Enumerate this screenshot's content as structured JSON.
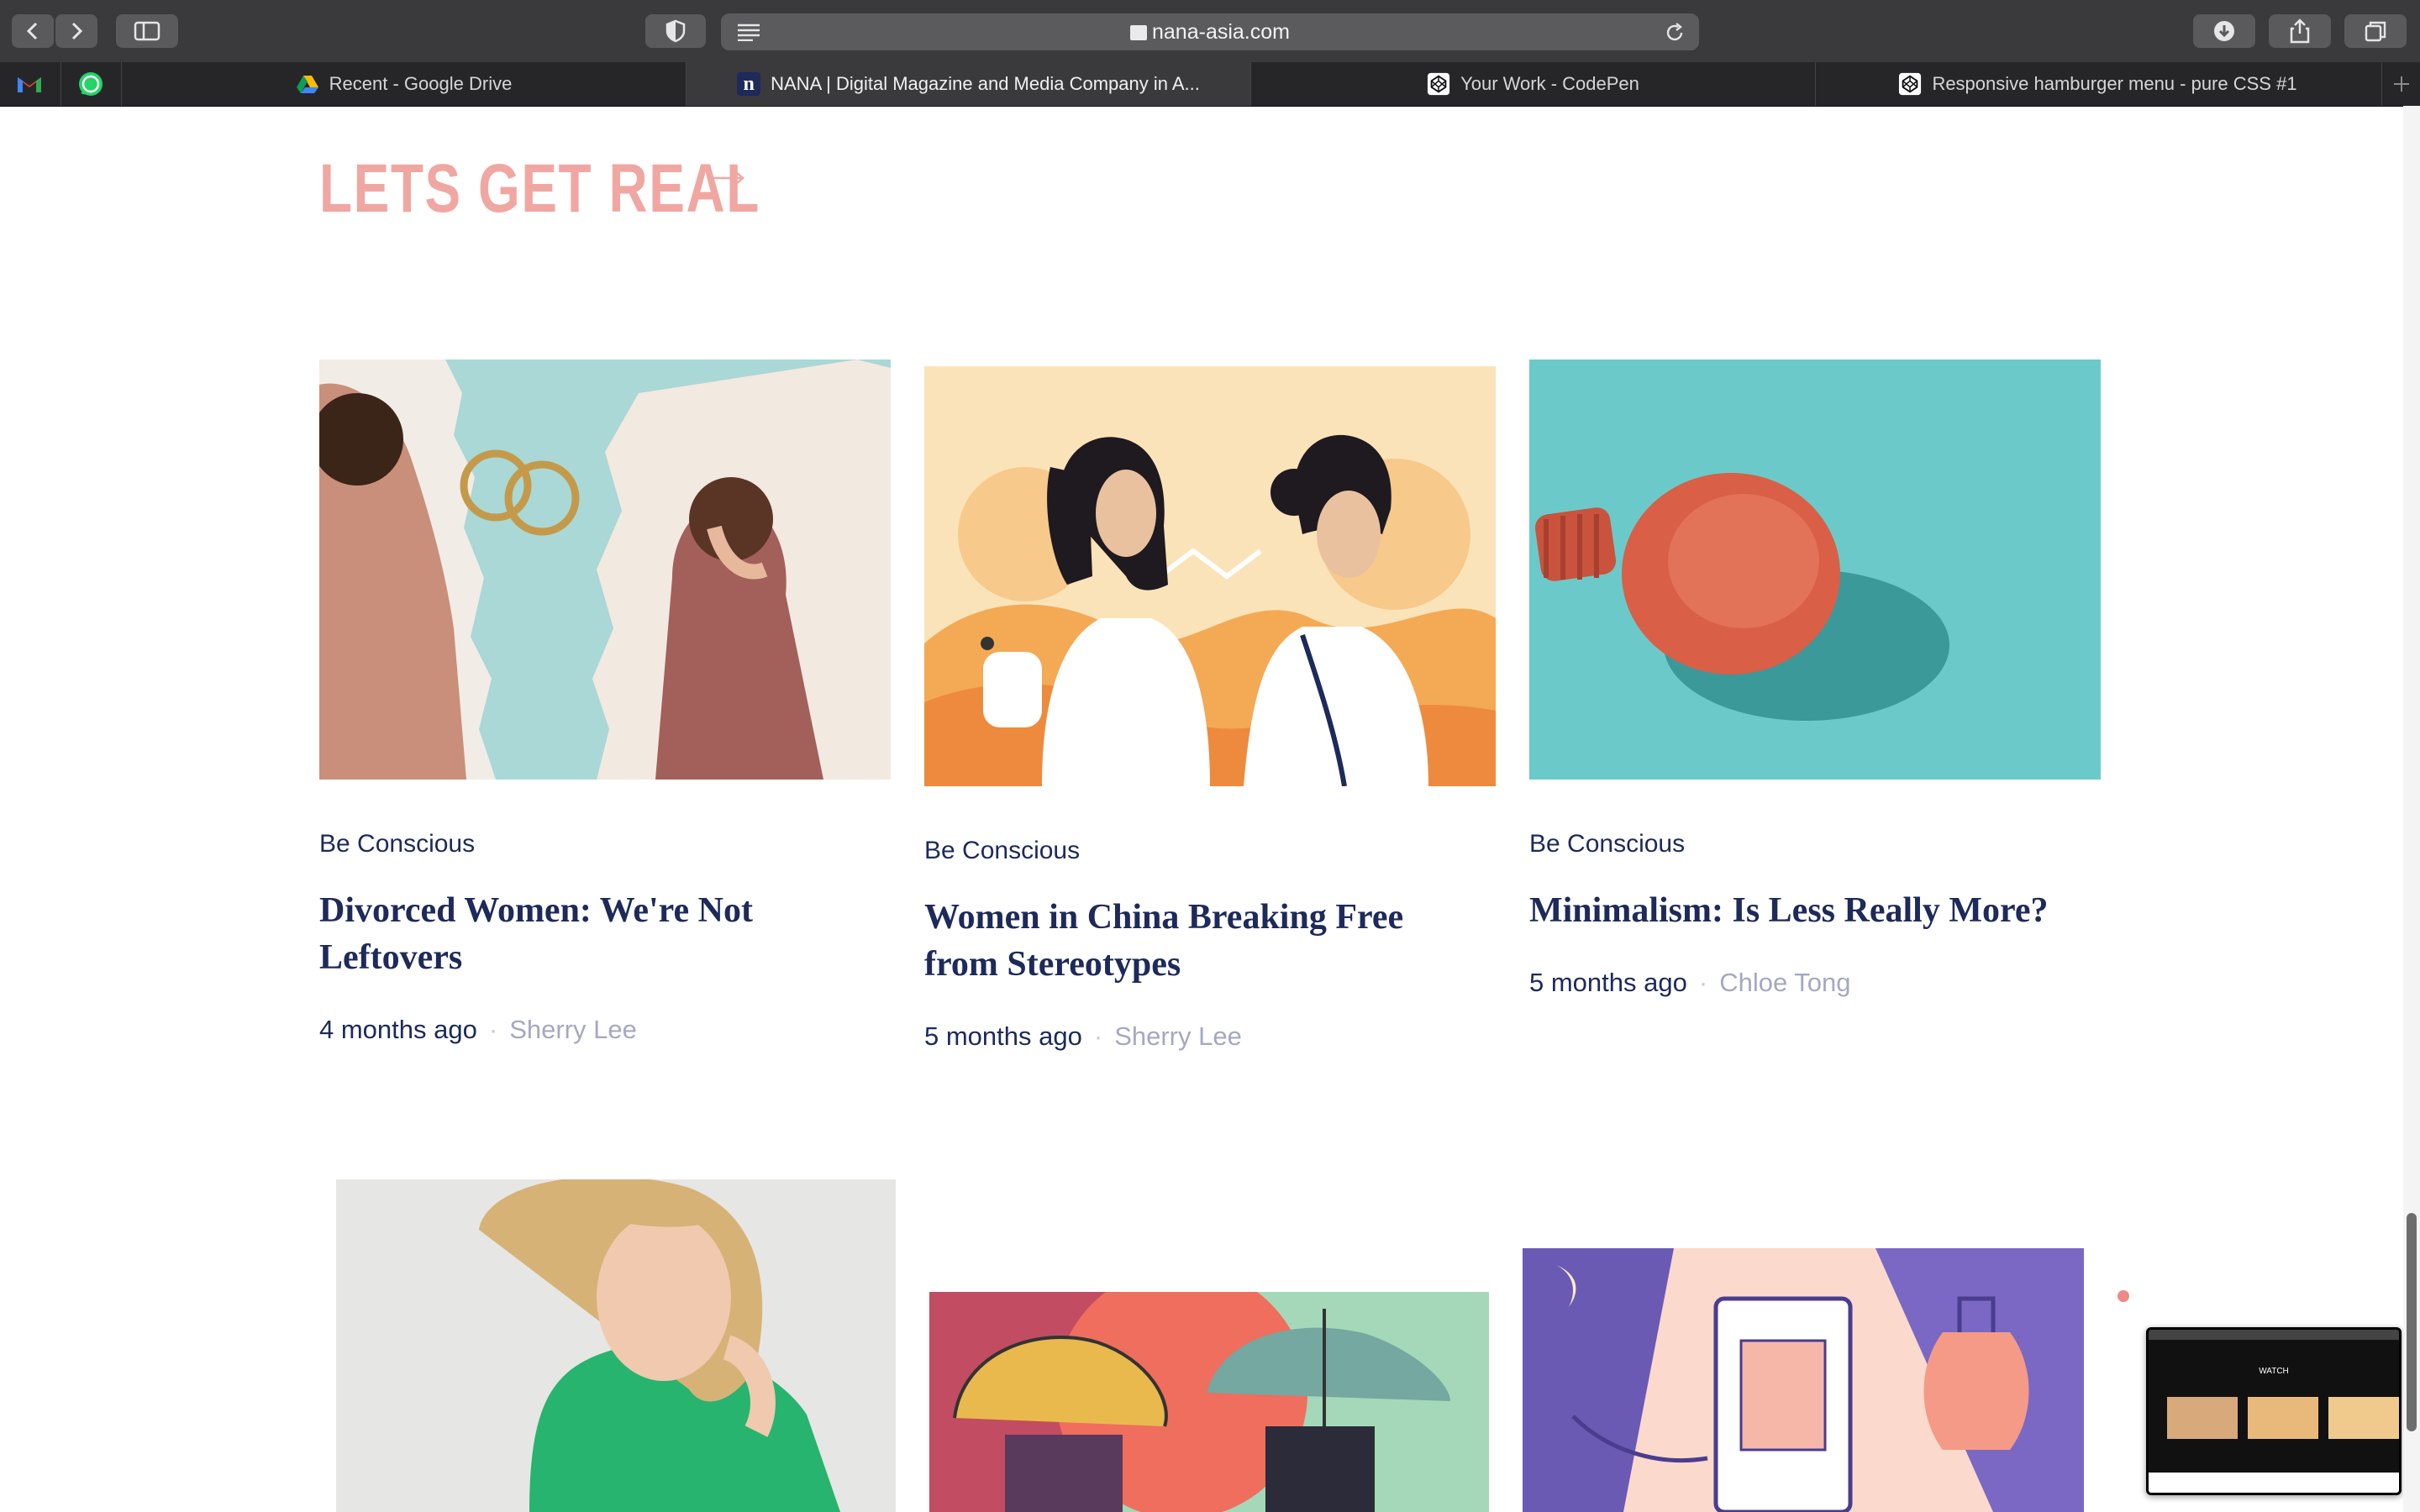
{
  "browser": {
    "url": "nana-asia.com",
    "tabs": [
      {
        "title": "Recent - Google Drive",
        "icon": "google-drive-icon",
        "active": false
      },
      {
        "title": "NANA | Digital Magazine and Media Company in A...",
        "icon": "nana-icon",
        "active": true
      },
      {
        "title": "Your Work - CodePen",
        "icon": "codepen-icon",
        "active": false
      },
      {
        "title": "Responsive hamburger menu - pure CSS #1",
        "icon": "codepen-icon",
        "active": false
      }
    ],
    "pinned": [
      "gmail-icon",
      "whatsapp-icon"
    ]
  },
  "section": {
    "title": "LETS GET REAL",
    "arrow_icon": "arrow-right-icon",
    "accent": "#f0a7a2"
  },
  "articles": [
    {
      "category": "Be Conscious",
      "title_line1": "Divorced Women: We're Not",
      "title_line2": "Leftovers",
      "time": "4 months ago",
      "author": "Sherry Lee"
    },
    {
      "category": "Be Conscious",
      "title_line1": "Women in China Breaking Free",
      "title_line2": "from Stereotypes",
      "time": "5 months ago",
      "author": "Sherry Lee"
    },
    {
      "category": "Be Conscious",
      "title_line1": "Minimalism: Is Less Really More?",
      "title_line2": "",
      "time": "5 months ago",
      "author": "Chloe Tong"
    }
  ],
  "colors": {
    "navy": "#1d2a5a",
    "author_gray": "#a5a8c2",
    "teal": "#6cc9c9"
  },
  "pip": {
    "label": "WATCH"
  }
}
